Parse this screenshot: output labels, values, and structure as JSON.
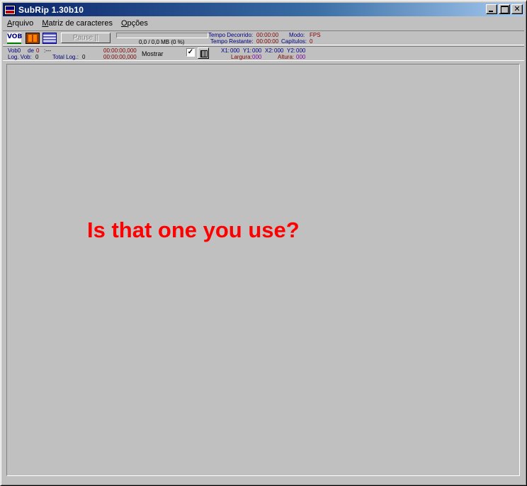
{
  "window": {
    "title": "SubRip 1.30b10"
  },
  "menu": {
    "items": [
      {
        "ul": "A",
        "rest": "rquivo"
      },
      {
        "ul": "M",
        "rest": "atriz de caracteres"
      },
      {
        "ul": "O",
        "rest": "pções"
      }
    ]
  },
  "toolbar": {
    "vob_icon": "VOB",
    "pause_label": "Pause ||",
    "progress_text": "0,0 / 0,0 MB (0 %)",
    "progress_percent": 0,
    "tempo_decorrido_label": "Tempo Decorrido:",
    "tempo_decorrido_value": "00:00:00",
    "tempo_restante_label": "Tempo Restante:",
    "tempo_restante_value": "00:00:00",
    "modo_label": "Modo:",
    "modo_value": "FPS",
    "capitulos_label": "Capítulos:",
    "capitulos_value": "0"
  },
  "info": {
    "vob_label": "Vob0",
    "de_label": "de",
    "de_value": "0",
    "dashes": ":---",
    "log_vob_label": "Log. Vob:",
    "log_vob_value": "0",
    "total_log_label": "Total Log.:",
    "total_log_value": "0",
    "time1": "00:00:00,000",
    "time2": "00:00:00,000",
    "mostrar_label": "Mostrar",
    "mostrar_checked": "✓",
    "x1_label": "X1:",
    "x1_value": "000",
    "y1_label": "Y1:",
    "y1_value": "000",
    "x2_label": "X2:",
    "x2_value": "000",
    "y2_label": "Y2:",
    "y2_value": "000",
    "largura_label": "Largura:",
    "largura_value": "000",
    "altura_label": "Altura:",
    "altura_value": "000"
  },
  "overlay_text": "Is that one you use?",
  "colors": {
    "titlebar_start": "#0a246a",
    "titlebar_end": "#a6caf0",
    "overlay": "#ff0000",
    "face": "#c0c0c0"
  }
}
